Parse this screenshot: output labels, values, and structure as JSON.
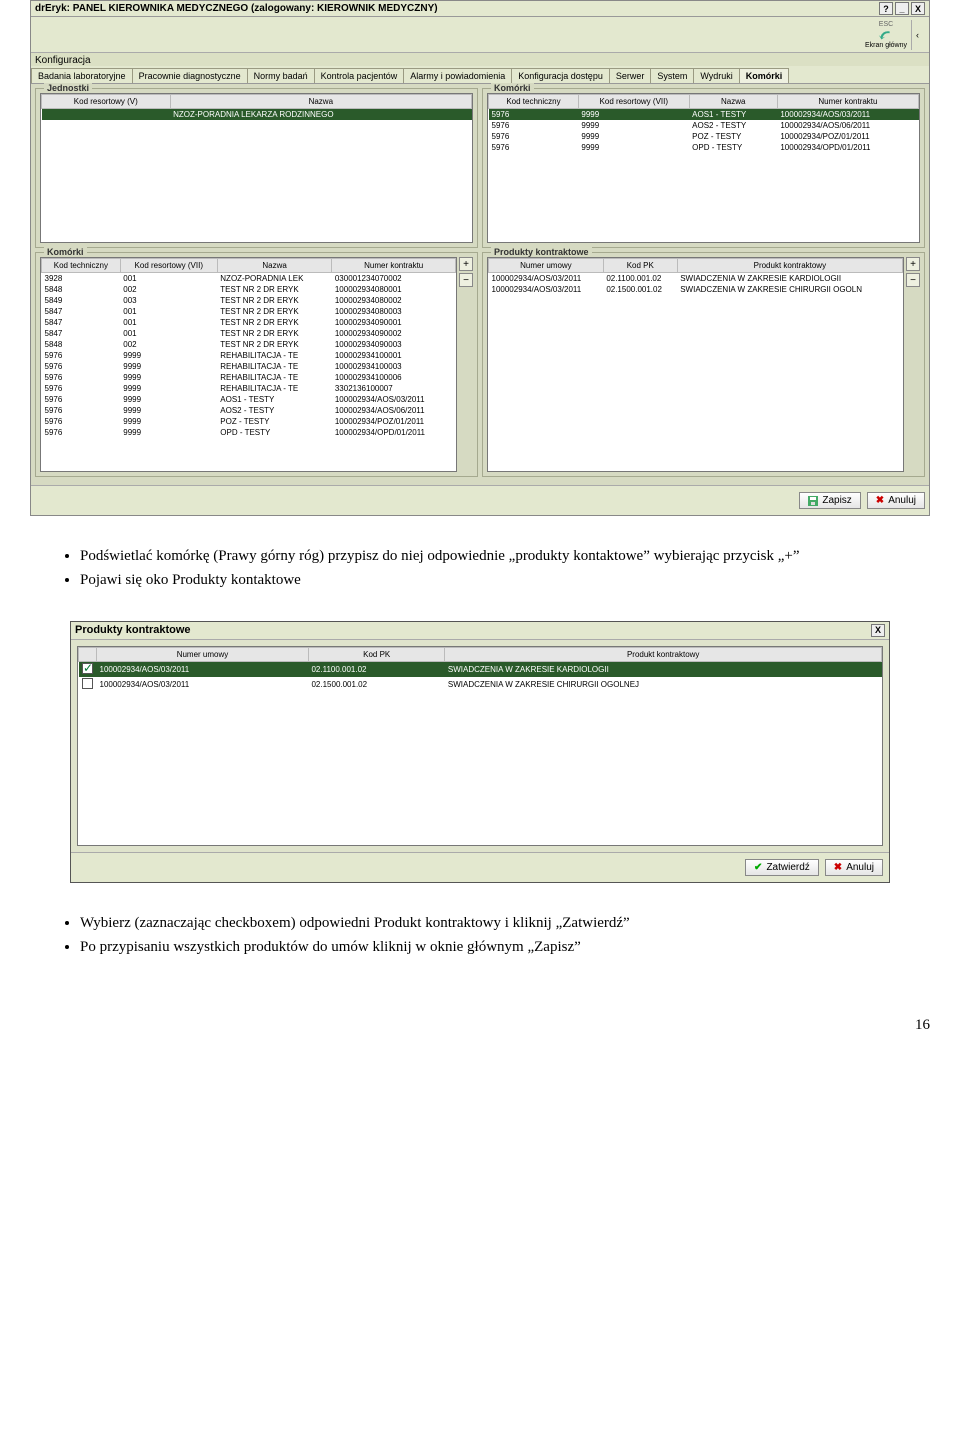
{
  "window": {
    "title": "drEryk: PANEL KIEROWNIKA MEDYCZNEGO (zalogowany: KIEROWNIK MEDYCZNY)",
    "help_btn": "?",
    "minimize_btn": "_",
    "close_btn": "X",
    "esc_label": "ESC",
    "main_screen_label": "Ekran główny",
    "menu_item": "Konfiguracja",
    "save_btn": "Zapisz",
    "cancel_btn": "Anuluj"
  },
  "tabs": [
    "Badania laboratoryjne",
    "Pracownie diagnostyczne",
    "Normy badań",
    "Kontrola pacjentów",
    "Alarmy i powiadomienia",
    "Konfiguracja dostępu",
    "Serwer",
    "System",
    "Wydruki",
    "Komórki"
  ],
  "active_tab_index": 9,
  "jednostki": {
    "legend": "Jednostki",
    "headers": [
      "Kod resortowy (V)",
      "Nazwa"
    ],
    "rows": [
      {
        "kod": "",
        "nazwa": "NZOZ-PORADNIA LEKARZA RODZINNEGO",
        "selected": true
      }
    ]
  },
  "komorki_top": {
    "legend": "Komórki",
    "headers": [
      "Kod techniczny",
      "Kod resortowy (VII)",
      "Nazwa",
      "Numer kontraktu"
    ],
    "rows": [
      {
        "c": [
          "5976",
          "9999",
          "AOS1 - TESTY",
          "100002934/AOS/03/2011"
        ],
        "selected": true
      },
      {
        "c": [
          "5976",
          "9999",
          "AOS2 - TESTY",
          "100002934/AOS/06/2011"
        ]
      },
      {
        "c": [
          "5976",
          "9999",
          "POZ - TESTY",
          "100002934/POZ/01/2011"
        ]
      },
      {
        "c": [
          "5976",
          "9999",
          "OPD - TESTY",
          "100002934/OPD/01/2011"
        ]
      }
    ]
  },
  "komorki_bottom": {
    "legend": "Komórki",
    "headers": [
      "Kod techniczny",
      "Kod resortowy (VII)",
      "Nazwa",
      "Numer kontraktu"
    ],
    "add_btn": "+",
    "remove_btn": "−",
    "rows": [
      {
        "c": [
          "3928",
          "001",
          "NZOZ-PORADNIA LEK",
          "030001234070002"
        ]
      },
      {
        "c": [
          "5848",
          "002",
          "TEST NR 2 DR ERYK",
          "100002934080001"
        ]
      },
      {
        "c": [
          "5849",
          "003",
          "TEST NR 2 DR ERYK",
          "100002934080002"
        ]
      },
      {
        "c": [
          "5847",
          "001",
          "TEST NR 2 DR ERYK",
          "100002934080003"
        ]
      },
      {
        "c": [
          "5847",
          "001",
          "TEST NR 2 DR ERYK",
          "100002934090001"
        ]
      },
      {
        "c": [
          "5847",
          "001",
          "TEST NR 2 DR ERYK",
          "100002934090002"
        ]
      },
      {
        "c": [
          "5848",
          "002",
          "TEST NR 2 DR ERYK",
          "100002934090003"
        ]
      },
      {
        "c": [
          "5976",
          "9999",
          "REHABILITACJA - TE",
          "100002934100001"
        ]
      },
      {
        "c": [
          "5976",
          "9999",
          "REHABILITACJA - TE",
          "100002934100003"
        ]
      },
      {
        "c": [
          "5976",
          "9999",
          "REHABILITACJA - TE",
          "100002934100006"
        ]
      },
      {
        "c": [
          "5976",
          "9999",
          "REHABILITACJA - TE",
          "3302136100007"
        ]
      },
      {
        "c": [
          "5976",
          "9999",
          "AOS1 - TESTY",
          "100002934/AOS/03/2011"
        ]
      },
      {
        "c": [
          "5976",
          "9999",
          "AOS2 - TESTY",
          "100002934/AOS/06/2011"
        ]
      },
      {
        "c": [
          "5976",
          "9999",
          "POZ - TESTY",
          "100002934/POZ/01/2011"
        ]
      },
      {
        "c": [
          "5976",
          "9999",
          "OPD - TESTY",
          "100002934/OPD/01/2011"
        ]
      }
    ]
  },
  "produkty": {
    "legend": "Produkty kontraktowe",
    "headers": [
      "Numer umowy",
      "Kod PK",
      "Produkt kontraktowy"
    ],
    "add_btn": "+",
    "remove_btn": "−",
    "rows": [
      {
        "c": [
          "100002934/AOS/03/2011",
          "02.1100.001.02",
          "SWIADCZENIA W ZAKRESIE KARDIOLOGII"
        ]
      },
      {
        "c": [
          "100002934/AOS/03/2011",
          "02.1500.001.02",
          "SWIADCZENIA W ZAKRESIE CHIRURGII OGOLN"
        ]
      }
    ]
  },
  "instructions1": [
    "Podświetlać komórkę (Prawy górny róg) przypisz do niej odpowiednie „produkty kontaktowe” wybierając przycisk „+”",
    "Pojawi się oko Produkty kontaktowe"
  ],
  "dialog": {
    "title": "Produkty kontraktowe",
    "close_btn": "X",
    "headers": [
      "",
      "Numer umowy",
      "Kod PK",
      "Produkt kontraktowy"
    ],
    "rows": [
      {
        "checked": true,
        "c": [
          "100002934/AOS/03/2011",
          "02.1100.001.02",
          "SWIADCZENIA W ZAKRESIE KARDIOLOGII"
        ],
        "selected": true
      },
      {
        "checked": false,
        "c": [
          "100002934/AOS/03/2011",
          "02.1500.001.02",
          "SWIADCZENIA W ZAKRESIE CHIRURGII OGOLNEJ"
        ]
      }
    ],
    "confirm_btn": "Zatwierdź",
    "cancel_btn": "Anuluj"
  },
  "instructions2": [
    "Wybierz (zaznaczając checkboxem) odpowiedni Produkt kontraktowy i kliknij „Zatwierdź”",
    "Po przypisaniu wszystkich produktów do umów kliknij w oknie głównym „Zapisz”"
  ],
  "page_number": "16"
}
